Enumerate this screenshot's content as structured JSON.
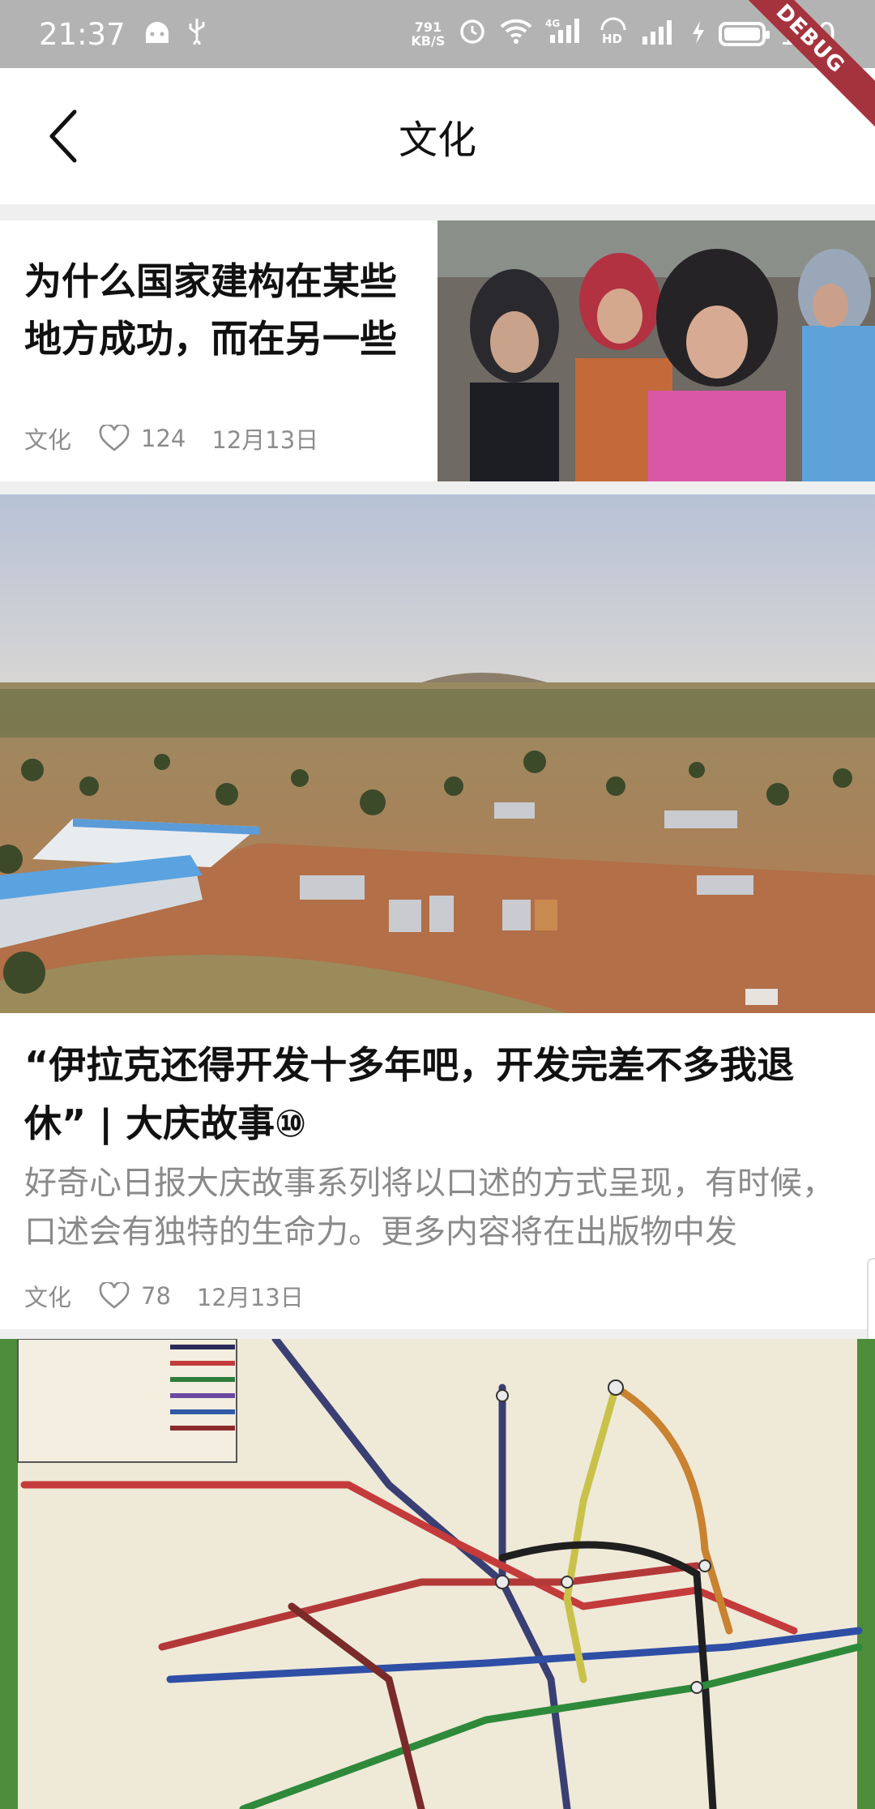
{
  "status_bar": {
    "time": "21:37",
    "net_speed_value": "791",
    "net_speed_unit": "KB/S",
    "network_label_4g": "4G",
    "network_label_hd": "HD",
    "battery": "100"
  },
  "debug_ribbon": "DEBUG",
  "appbar": {
    "title": "文化"
  },
  "articles": [
    {
      "title": "为什么国家建构在某些地方成功，而在另一些",
      "category": "文化",
      "likes": "124",
      "date": "12月13日"
    },
    {
      "title": "“伊拉克还得开发十多年吧，开发完差不多我退休” | 大庆故事⑩",
      "summary": "好奇心日报大庆故事系列将以口述的方式呈现，有时候，口述会有独特的生命力。更多内容将在出版物中发",
      "category": "文化",
      "likes": "78",
      "date": "12月13日"
    }
  ],
  "icons": {
    "back": "chevron-left-icon",
    "like": "heart-outline-icon"
  }
}
